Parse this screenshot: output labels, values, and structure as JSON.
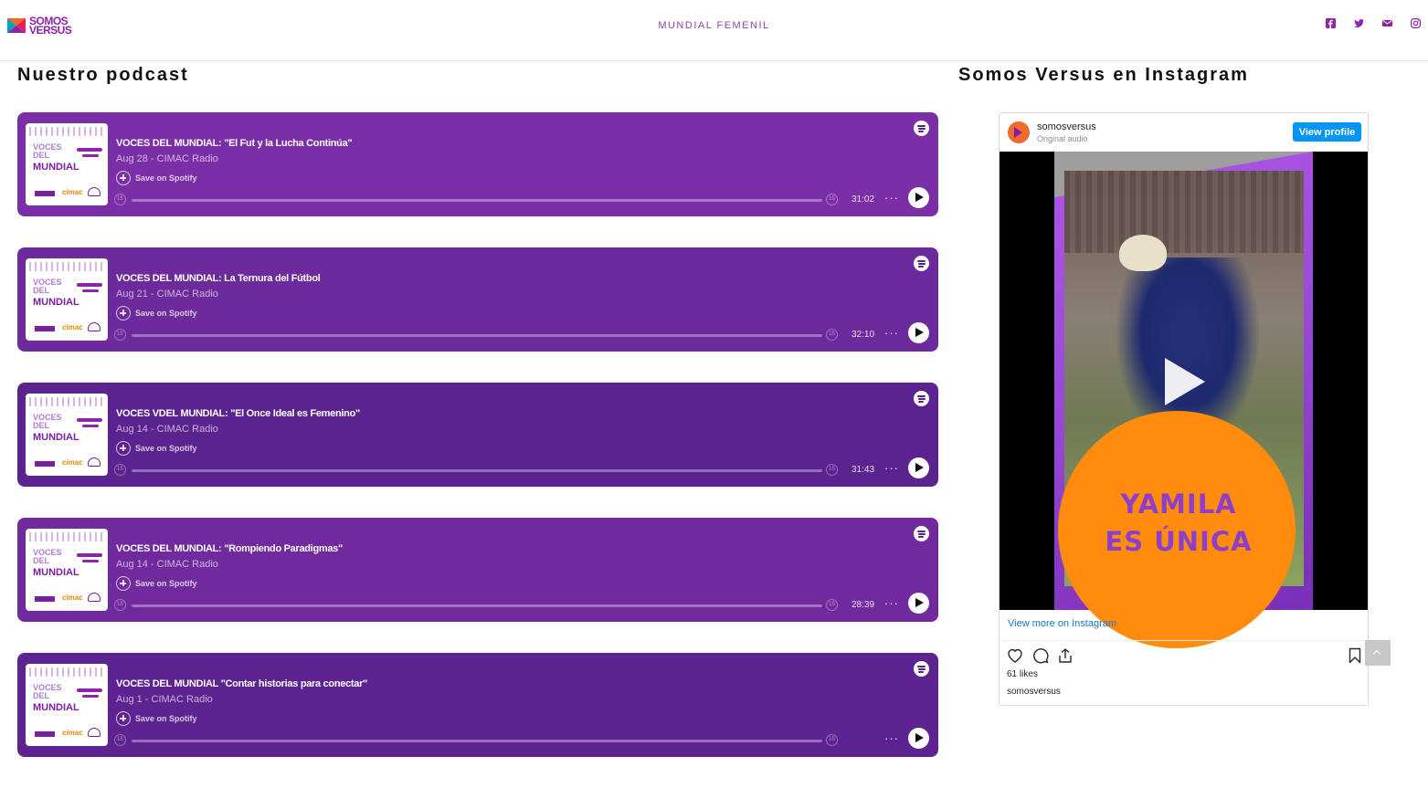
{
  "brand": {
    "line1": "SOMOS",
    "line2": "VERSUS"
  },
  "nav": {
    "center_link": "MUNDIAL FEMENIL"
  },
  "social": [
    "facebook-icon",
    "twitter-icon",
    "envelope-icon",
    "instagram-icon"
  ],
  "podcast": {
    "heading": "Nuestro podcast",
    "save_label": "Save on Spotify",
    "skip_back": "15",
    "skip_fwd": "15",
    "cover": {
      "line1": "VOCES",
      "line2": "DEL",
      "line3": "MUNDIAL",
      "partner": "cimac"
    },
    "episodes": [
      {
        "title": "VOCES DEL MUNDIAL: \"El Fut y la Lucha Continúa\"",
        "meta": "Aug 28 - CIMAC Radio",
        "duration": "31:02",
        "color": "#7a2fa6"
      },
      {
        "title": "VOCES DEL MUNDIAL: La Ternura del Fútbol",
        "meta": "Aug 21 - CIMAC Radio",
        "duration": "32:10",
        "color": "#6c2a9c"
      },
      {
        "title": "VOCES VDEL MUNDIAL: \"El Once Ideal es Femenino\"",
        "meta": "Aug 14 - CIMAC Radio",
        "duration": "31:43",
        "color": "#5b2390"
      },
      {
        "title": "VOCES DEL MUNDIAL: \"Rompiendo Paradigmas\"",
        "meta": "Aug 14 - CIMAC Radio",
        "duration": "28:39",
        "color": "#712a9e"
      },
      {
        "title": "VOCES DEL MUNDIAL \"Contar historias para conectar\"",
        "meta": "Aug 1 - CIMAC Radio",
        "duration": "",
        "color": "#5c2391"
      }
    ]
  },
  "instagram": {
    "heading": "Somos Versus en Instagram",
    "username": "somosversus",
    "subtitle": "Original audio",
    "view_profile": "View profile",
    "reel_line1": "YAMILA",
    "reel_line2": "ES ÚNICA",
    "view_more": "View more on Instagram",
    "likes": "61 likes",
    "caption_user": "somosversus"
  }
}
